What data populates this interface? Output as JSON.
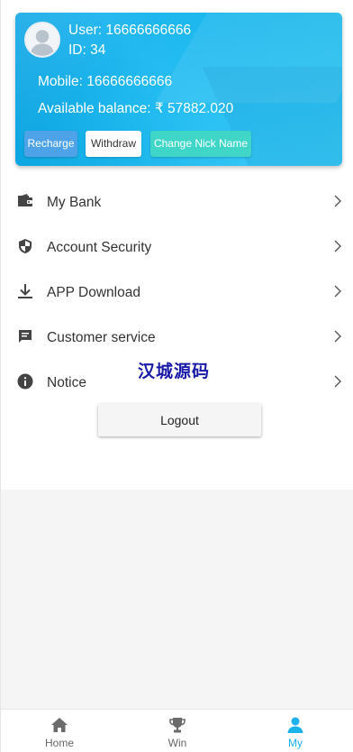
{
  "profile": {
    "user_label": "User: 16666666666",
    "id_label": "ID: 34",
    "mobile_label": "Mobile: 16666666666",
    "balance_label": "Available balance: ₹ 57882.020"
  },
  "actions": {
    "recharge": "Recharge",
    "withdraw": "Withdraw",
    "change_nick": "Change Nick Name"
  },
  "menu": {
    "items": [
      {
        "label": "My Bank",
        "icon": "wallet-icon"
      },
      {
        "label": "Account Security",
        "icon": "shield-icon"
      },
      {
        "label": "APP Download",
        "icon": "download-icon"
      },
      {
        "label": "Customer service",
        "icon": "chat-icon"
      },
      {
        "label": "Notice",
        "icon": "info-icon"
      }
    ]
  },
  "watermark": "汉城源码",
  "logout_label": "Logout",
  "tabbar": {
    "items": [
      {
        "label": "Home",
        "icon": "home-icon"
      },
      {
        "label": "Win",
        "icon": "trophy-icon"
      },
      {
        "label": "My",
        "icon": "person-icon",
        "active": true
      }
    ]
  },
  "colors": {
    "card_gradient_start": "#08a7ea",
    "card_gradient_end": "#2cc8f7",
    "recharge_button": "#4ea2e8",
    "nick_button": "#3fd6c8",
    "active_tab": "#1bb1ea",
    "watermark": "#1a1aa8"
  }
}
